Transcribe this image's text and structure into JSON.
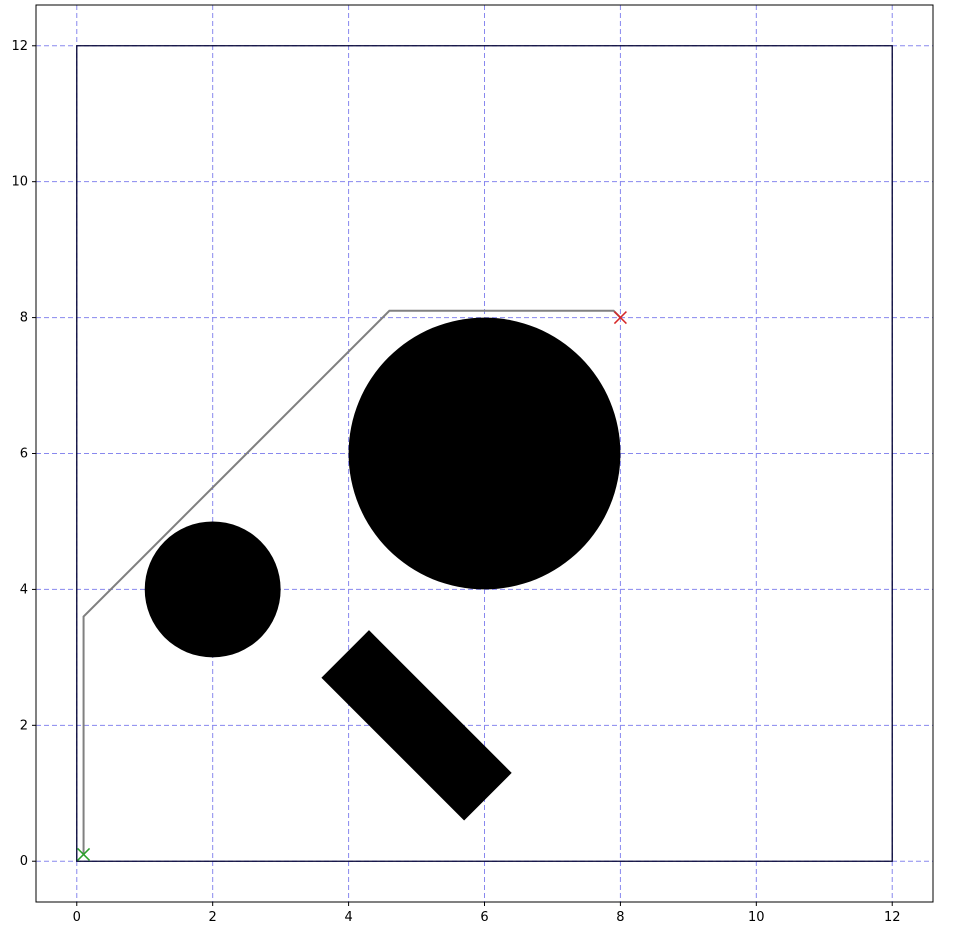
{
  "chart_data": {
    "type": "scatter",
    "title": "",
    "xlabel": "",
    "ylabel": "",
    "xlim": [
      -0.6,
      12.6
    ],
    "ylim": [
      -0.6,
      12.6
    ],
    "x_ticks": [
      0,
      2,
      4,
      6,
      8,
      10,
      12
    ],
    "y_ticks": [
      0,
      2,
      4,
      6,
      8,
      10,
      12
    ],
    "x_tick_labels": [
      "0",
      "2",
      "4",
      "6",
      "8",
      "10",
      "12"
    ],
    "y_tick_labels": [
      "0",
      "2",
      "4",
      "6",
      "8",
      "10",
      "12"
    ],
    "grid": true,
    "grid_color": "#8888ee",
    "boundary": {
      "color": "#000033",
      "corners": [
        [
          0,
          0
        ],
        [
          12,
          0
        ],
        [
          12,
          12
        ],
        [
          0,
          12
        ]
      ]
    },
    "obstacles": [
      {
        "shape": "circle",
        "center": [
          2,
          4
        ],
        "radius": 1,
        "color": "#000000"
      },
      {
        "shape": "circle",
        "center": [
          6,
          6
        ],
        "radius": 2,
        "color": "#000000"
      },
      {
        "shape": "polygon",
        "points": [
          [
            3.6,
            2.7
          ],
          [
            4.3,
            3.4
          ],
          [
            6.4,
            1.3
          ],
          [
            5.7,
            0.6
          ]
        ],
        "color": "#000000"
      }
    ],
    "path": {
      "color": "#808080",
      "points": [
        [
          0.1,
          0.1
        ],
        [
          0.1,
          3.6
        ],
        [
          4.6,
          8.1
        ],
        [
          7.9,
          8.1
        ],
        [
          8.0,
          8.0
        ]
      ]
    },
    "start": {
      "x": 0.1,
      "y": 0.1,
      "marker": "x",
      "color": "#2ca02c"
    },
    "goal": {
      "x": 8.0,
      "y": 8.0,
      "marker": "x",
      "color": "#d62728"
    }
  }
}
